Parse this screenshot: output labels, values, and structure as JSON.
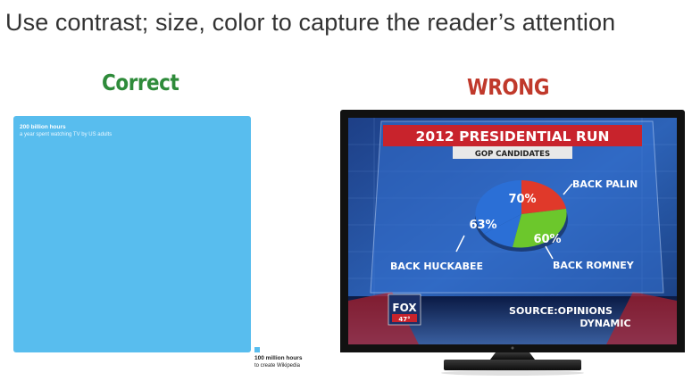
{
  "slide": {
    "title": "Use contrast; size, color to capture the reader’s attention"
  },
  "correct": {
    "label": "Correct",
    "big_title": "200 billion hours",
    "big_subtitle": "a year spent watching TV by US adults",
    "small_title": "100 million hours",
    "small_subtitle": "to create Wikipedia",
    "color": "#58bdee"
  },
  "wrong": {
    "label": "WRONG",
    "tv": {
      "header": "2012 PRESIDENTIAL RUN",
      "subheader": "GOP CANDIDATES",
      "palin_label": "BACK PALIN",
      "palin_pct": "70%",
      "huckabee_label": "BACK HUCKABEE",
      "huckabee_pct": "63%",
      "romney_label": "BACK ROMNEY",
      "romney_pct": "60%",
      "source": "SOURCE:OPINIONS",
      "source2": "DYNAMIC",
      "logo": "FOX",
      "temperature": "47°"
    },
    "colors": {
      "red": "#e0392a",
      "blue": "#2b6fd6",
      "green": "#6cc72c",
      "header_red": "#c8232c"
    }
  }
}
